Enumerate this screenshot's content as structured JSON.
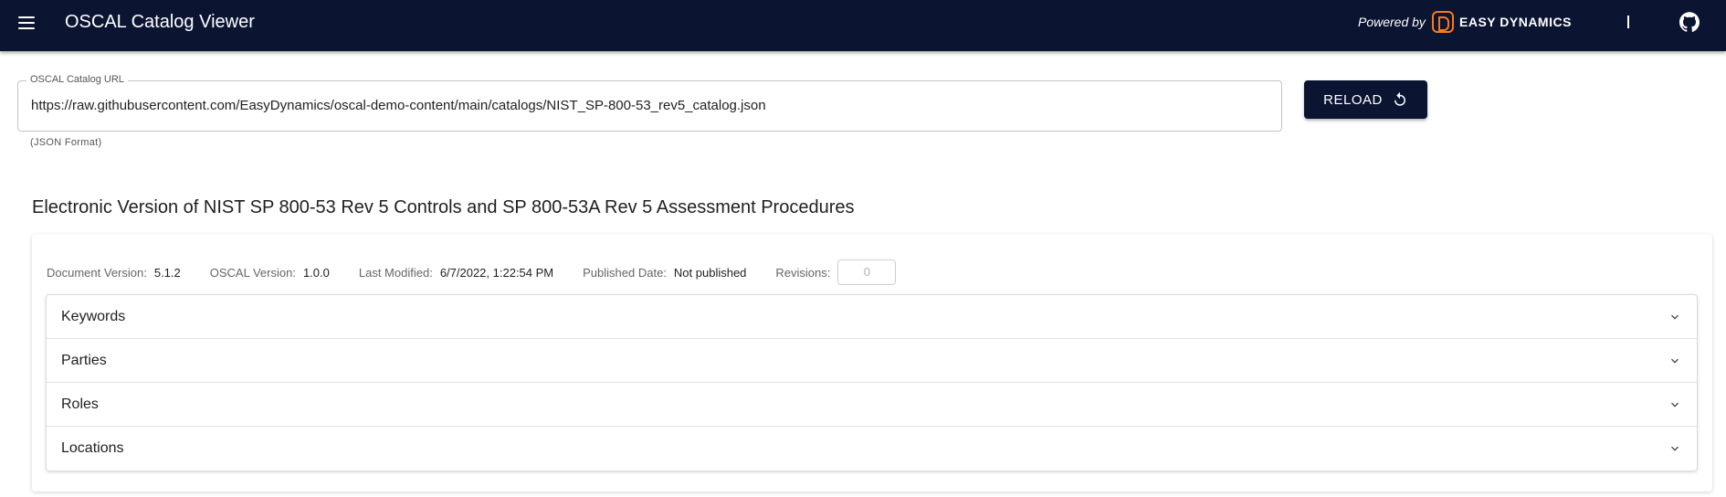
{
  "appbar": {
    "title": "OSCAL Catalog Viewer",
    "powered_by": "Powered by",
    "brand": "EASY DYNAMICS",
    "colors": {
      "background": "#0b1431",
      "brand_accent": "#f47a20"
    },
    "icons": [
      "menu-icon",
      "easy-dynamics-logo",
      "github-icon"
    ]
  },
  "url_field": {
    "label": "OSCAL Catalog URL",
    "value": "https://raw.githubusercontent.com/EasyDynamics/oscal-demo-content/main/catalogs/NIST_SP-800-53_rev5_catalog.json",
    "helper": "(JSON Format)"
  },
  "reload_button": {
    "label": "RELOAD",
    "icon": "refresh-icon"
  },
  "catalog": {
    "title": "Electronic Version of NIST SP 800-53 Rev 5 Controls and SP 800-53A Rev 5 Assessment Procedures",
    "meta": {
      "document_version_label": "Document Version:",
      "document_version": "5.1.2",
      "oscal_version_label": "OSCAL Version:",
      "oscal_version": "1.0.0",
      "last_modified_label": "Last Modified:",
      "last_modified": "6/7/2022, 1:22:54 PM",
      "published_label": "Published Date:",
      "published": "Not published",
      "revisions_label": "Revisions:",
      "revisions": "0"
    },
    "sections": [
      {
        "label": "Keywords"
      },
      {
        "label": "Parties"
      },
      {
        "label": "Roles"
      },
      {
        "label": "Locations"
      }
    ]
  }
}
